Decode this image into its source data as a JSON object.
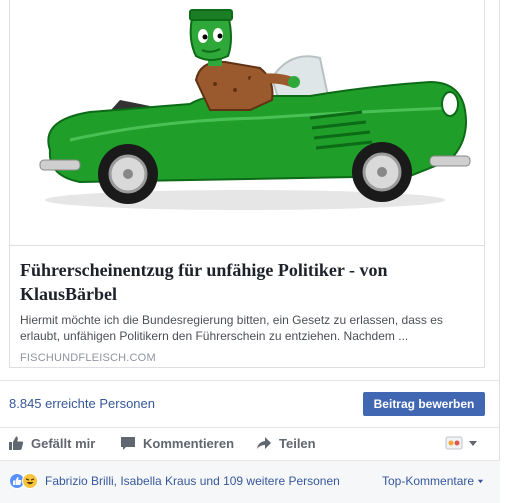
{
  "link_preview": {
    "title": "Führerscheinentzug für unfähige Politiker - von KlausBärbel",
    "description": "Hiermit möchte ich die Bundesregierung bitten, ein Gesetz zu erlassen, dass es erlaubt, unfähigen Politikern den Führerschein zu entziehen. Nachdem ...",
    "domain": "FISCHUNDFLEISCH.COM"
  },
  "insights": {
    "reach_text": "8.845 erreichte Personen",
    "promote_label": "Beitrag bewerben"
  },
  "actions": {
    "like_label": "Gefällt mir",
    "comment_label": "Kommentieren",
    "share_label": "Teilen"
  },
  "reactions": {
    "names_text": "Fabrizio Brilli, Isabella Kraus und 109 weitere Personen",
    "sort_label": "Top-Kommentare",
    "icons": [
      "like-reaction-icon",
      "haha-reaction-icon"
    ]
  },
  "colors": {
    "link": "#365899",
    "primary_button": "#4267b2",
    "car_green": "#1f9e2a"
  }
}
